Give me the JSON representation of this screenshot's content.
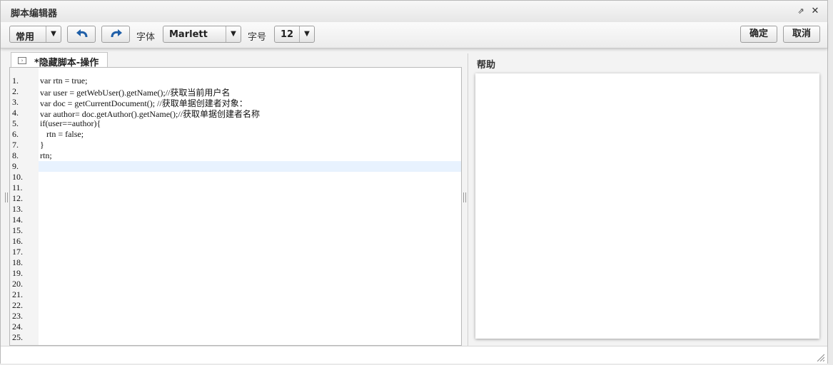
{
  "window": {
    "title": "脚本编辑器"
  },
  "toolbar": {
    "mode_select": "常用",
    "font_label": "字体",
    "font_value": "Marlett",
    "size_label": "字号",
    "size_value": "12",
    "ok_label": "确定",
    "cancel_label": "取消"
  },
  "editor": {
    "tab_label": "*隐藏脚本-操作",
    "line_numbers": [
      "1.",
      "2.",
      "3.",
      "4.",
      "5.",
      "6.",
      "7.",
      "8.",
      "9.",
      "10.",
      "11.",
      "12.",
      "13.",
      "14.",
      "15.",
      "16.",
      "17.",
      "18.",
      "19.",
      "20.",
      "21.",
      "22.",
      "23.",
      "24.",
      "25."
    ],
    "lines": [
      "var rtn = true;",
      "var user = getWebUser().getName();//获取当前用户名",
      "var doc = getCurrentDocument(); //获取单据创建者对象：",
      "var author= doc.getAuthor().getName();//获取单据创建者名称",
      "if(user==author){",
      "   rtn = false;",
      "}",
      "rtn;"
    ]
  },
  "help": {
    "title": "帮助"
  }
}
